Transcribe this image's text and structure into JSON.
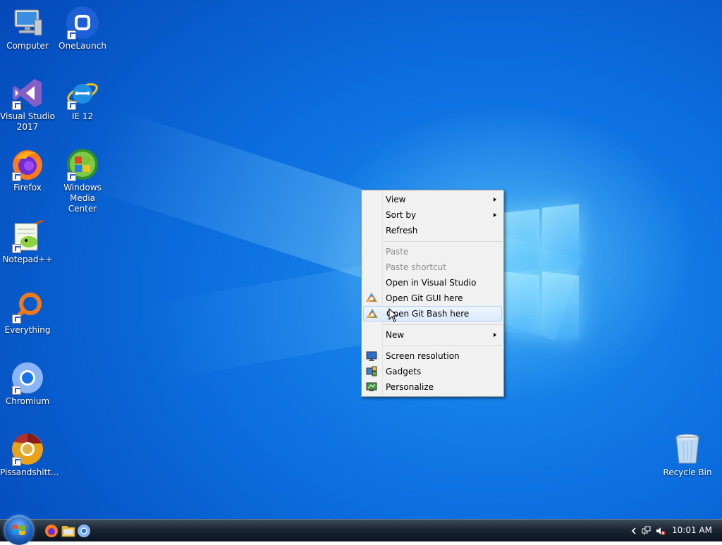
{
  "desktop": {
    "icons": [
      {
        "label": "Computer"
      },
      {
        "label": "OneLaunch"
      },
      {
        "label": "Visual Studio 2017"
      },
      {
        "label": "IE 12"
      },
      {
        "label": "Firefox"
      },
      {
        "label": "Windows Media Center"
      },
      {
        "label": "Notepad++"
      },
      {
        "label": "Everything"
      },
      {
        "label": "Chromium"
      },
      {
        "label": "Pissandshitt..."
      },
      {
        "label": "Recycle Bin"
      }
    ]
  },
  "context_menu": {
    "items": [
      {
        "label": "View",
        "submenu": true
      },
      {
        "label": "Sort by",
        "submenu": true
      },
      {
        "label": "Refresh"
      },
      {
        "label": "Paste",
        "disabled": true
      },
      {
        "label": "Paste shortcut",
        "disabled": true
      },
      {
        "label": "Open in Visual Studio"
      },
      {
        "label": "Open Git GUI here",
        "icon": "git-icon"
      },
      {
        "label": "Open Git Bash here",
        "icon": "git-icon",
        "highlighted": true
      },
      {
        "label": "New",
        "submenu": true
      },
      {
        "label": "Screen resolution",
        "icon": "monitor-icon"
      },
      {
        "label": "Gadgets",
        "icon": "gadgets-icon"
      },
      {
        "label": "Personalize",
        "icon": "personalize-icon"
      }
    ]
  },
  "taskbar": {
    "pinned": [
      {
        "icon": "firefox-icon"
      },
      {
        "icon": "explorer-folder-icon"
      },
      {
        "icon": "chromium-icon"
      }
    ],
    "clock": "10:01 AM"
  },
  "colors": {
    "desktop_blue": "#0c6fe0",
    "menu_bg": "#f1f1f1",
    "menu_highlight": "#dbeafc"
  }
}
